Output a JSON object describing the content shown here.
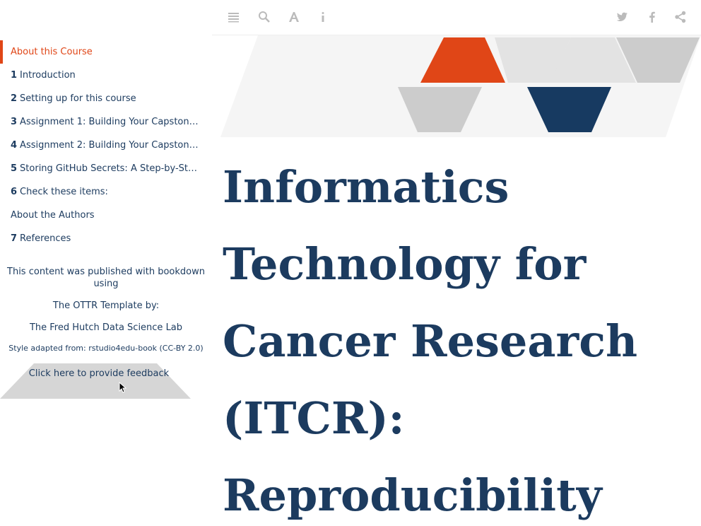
{
  "sidebar": {
    "toc": [
      {
        "num": "",
        "label": "About this Course",
        "active": true
      },
      {
        "num": "1",
        "label": "Introduction"
      },
      {
        "num": "2",
        "label": "Setting up for this course"
      },
      {
        "num": "3",
        "label": "Assignment 1: Building Your Capstone …"
      },
      {
        "num": "4",
        "label": "Assignment 2: Building Your Capstone …"
      },
      {
        "num": "5",
        "label": "Storing GitHub Secrets: A Step-by-Step …"
      },
      {
        "num": "6",
        "label": "Check these items:"
      },
      {
        "num": "",
        "label": "About the Authors"
      },
      {
        "num": "7",
        "label": "References"
      }
    ],
    "published": "This content was published with bookdown using",
    "ottr": "The OTTR Template by:",
    "lab": "The Fred Hutch Data Science Lab",
    "style": "Style adapted from: rstudio4edu-book (CC-BY 2.0)",
    "feedback": "Click here to provide feedback"
  },
  "toolbar": {
    "icons": [
      "menu-icon",
      "search-icon",
      "font-icon",
      "info-icon",
      "twitter-icon",
      "facebook-icon",
      "share-icon"
    ]
  },
  "main": {
    "title": "Informatics Technology for Cancer Research (ITCR): Reproducibility"
  },
  "colors": {
    "accent": "#e04617",
    "navy": "#1c3b5f",
    "light_gray": "#f5f5f5",
    "mid_gray": "#cccccc"
  }
}
